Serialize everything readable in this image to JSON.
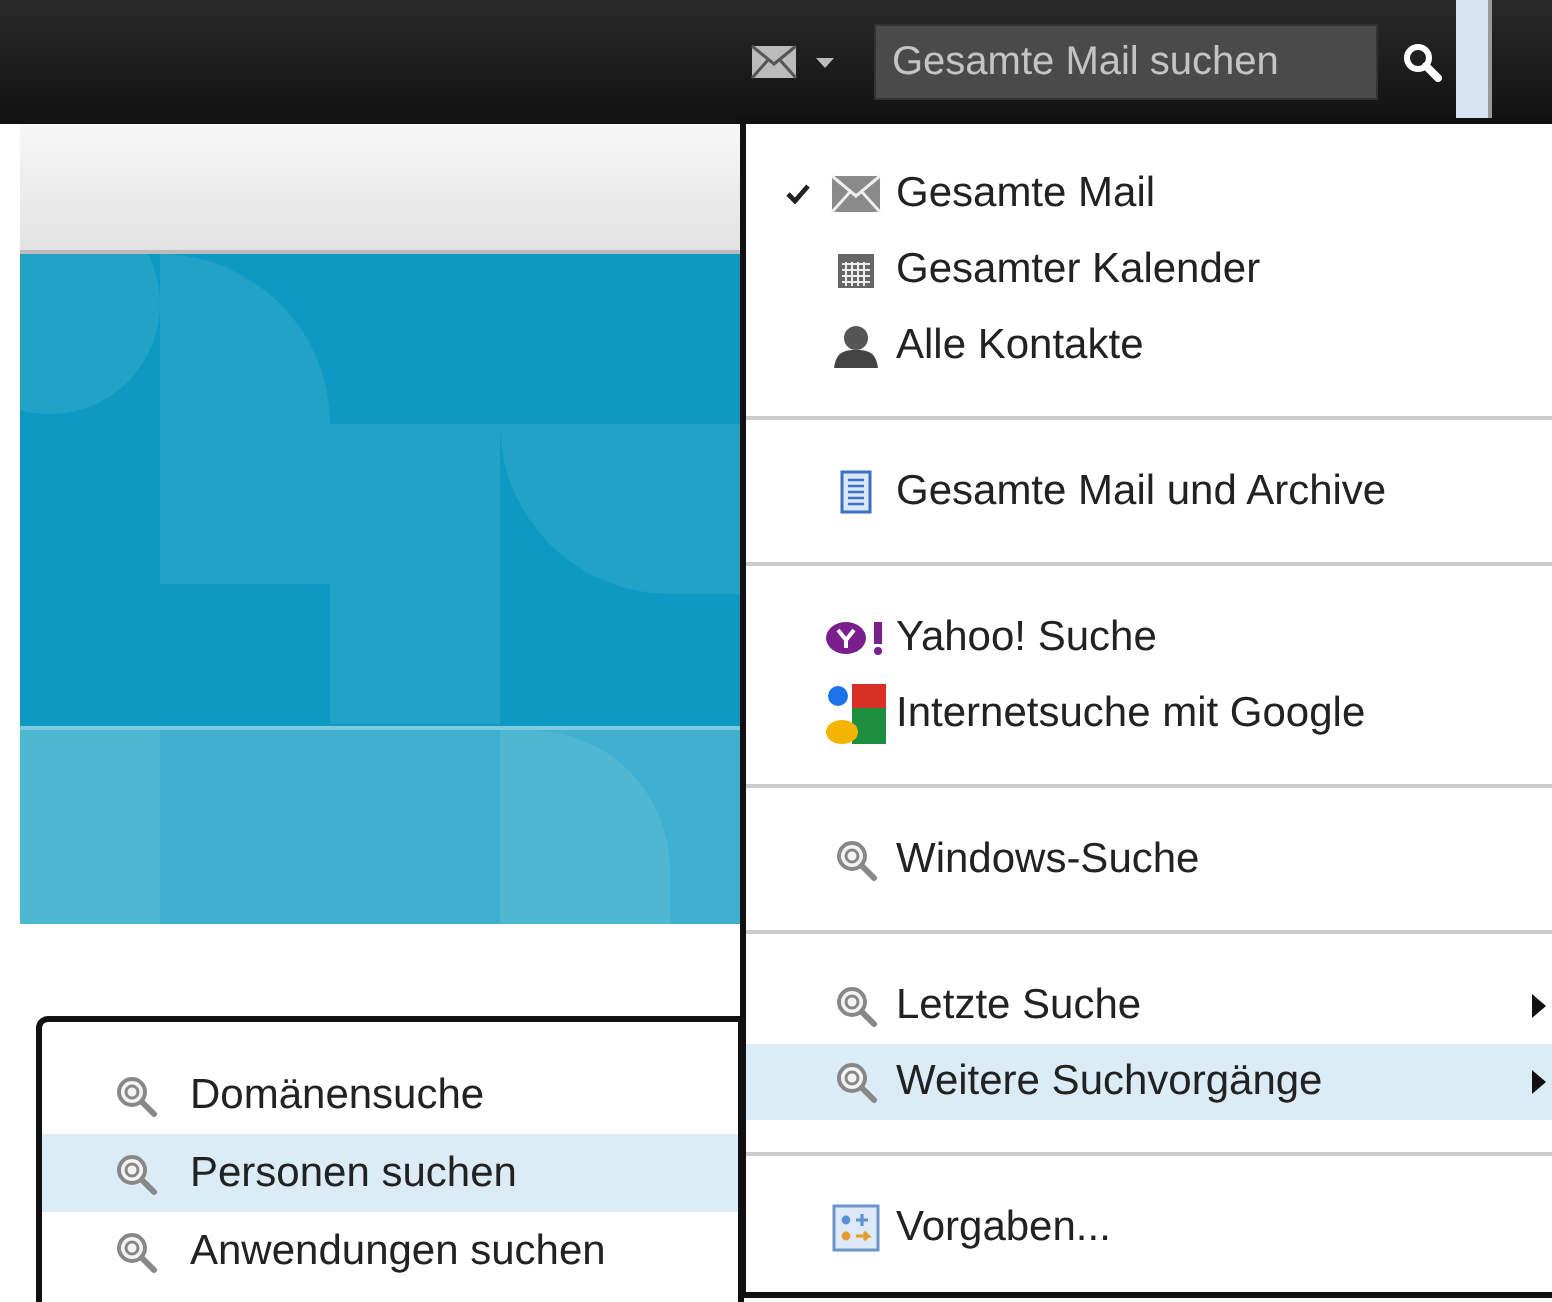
{
  "toolbar": {
    "search": {
      "placeholder": "Gesamte Mail suchen"
    }
  },
  "menu": {
    "groups": [
      {
        "items": [
          {
            "kind": "mail",
            "label": "Gesamte Mail",
            "checked": true,
            "selected": false,
            "submenu": false
          },
          {
            "kind": "calendar",
            "label": "Gesamter Kalender",
            "checked": false,
            "selected": false,
            "submenu": false
          },
          {
            "kind": "contact",
            "label": "Alle Kontakte",
            "checked": false,
            "selected": false,
            "submenu": false
          }
        ]
      },
      {
        "items": [
          {
            "kind": "archive",
            "label": "Gesamte Mail und Archive",
            "checked": false,
            "selected": false,
            "submenu": false
          }
        ]
      },
      {
        "items": [
          {
            "kind": "yahoo",
            "label": "Yahoo! Suche",
            "checked": false,
            "selected": false,
            "submenu": false
          },
          {
            "kind": "google",
            "label": "Internetsuche mit Google",
            "checked": false,
            "selected": false,
            "submenu": false
          }
        ]
      },
      {
        "items": [
          {
            "kind": "search",
            "label": "Windows-Suche",
            "checked": false,
            "selected": false,
            "submenu": false
          }
        ]
      },
      {
        "items": [
          {
            "kind": "search",
            "label": "Letzte Suche",
            "checked": false,
            "selected": false,
            "submenu": true
          },
          {
            "kind": "search",
            "label": "Weitere Suchvorgänge",
            "checked": false,
            "selected": true,
            "submenu": true
          }
        ]
      },
      {
        "items": [
          {
            "kind": "settings",
            "label": "Vorgaben...",
            "checked": false,
            "selected": false,
            "submenu": false
          }
        ]
      }
    ]
  },
  "submenu": {
    "items": [
      {
        "label": "Domänensuche",
        "selected": false
      },
      {
        "label": "Personen suchen",
        "selected": true
      },
      {
        "label": "Anwendungen suchen",
        "selected": false
      }
    ]
  }
}
